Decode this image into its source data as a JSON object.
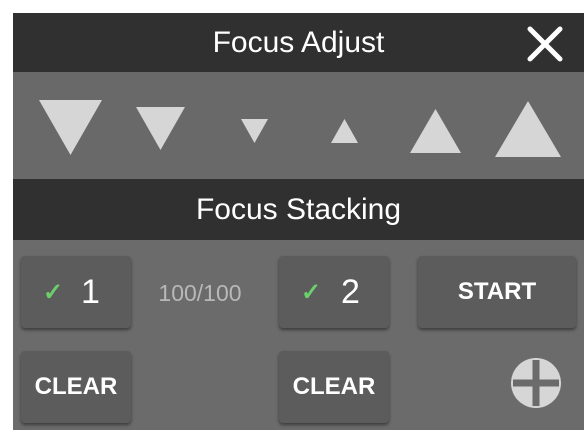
{
  "header": {
    "title": "Focus Adjust",
    "close_icon": "close-icon"
  },
  "focus_adjust": {
    "buttons": [
      {
        "icon": "triangle-down-large-icon"
      },
      {
        "icon": "triangle-down-medium-icon"
      },
      {
        "icon": "triangle-down-small-icon"
      },
      {
        "icon": "triangle-up-small-icon"
      },
      {
        "icon": "triangle-up-medium-icon"
      },
      {
        "icon": "triangle-up-large-icon"
      }
    ]
  },
  "focus_stacking": {
    "title": "Focus Stacking",
    "slot1": {
      "check": "✓",
      "label": "1",
      "checked": true
    },
    "slot2": {
      "check": "✓",
      "label": "2",
      "checked": true
    },
    "progress": "100/100",
    "start_label": "START",
    "clear1_label": "CLEAR",
    "clear2_label": "CLEAR",
    "add_icon": "plus-circle-icon"
  },
  "colors": {
    "panel": "#6b6b6b",
    "bar": "#303030",
    "button": "#5c5c5c",
    "check": "#6bd06b",
    "triangle": "#d6d6d6"
  }
}
